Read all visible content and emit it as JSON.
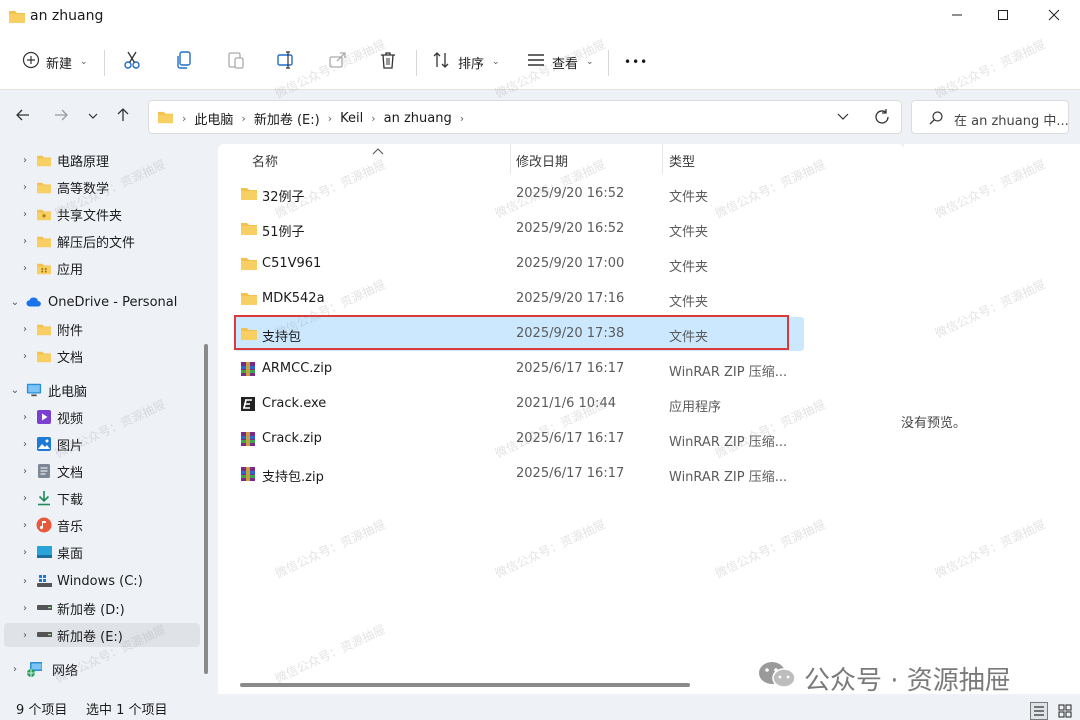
{
  "window": {
    "title": "an zhuang"
  },
  "toolbar": {
    "new_label": "新建",
    "sort_label": "排序",
    "view_label": "查看",
    "more_label": "•••"
  },
  "address": {
    "crumbs": [
      "此电脑",
      "新加卷 (E:)",
      "Keil",
      "an zhuang"
    ],
    "search_placeholder": "在 an zhuang 中..."
  },
  "sidebar": {
    "items": [
      {
        "label": "电路原理",
        "icon": "folder-icon"
      },
      {
        "label": "高等数学",
        "icon": "folder-icon"
      },
      {
        "label": "共享文件夹",
        "icon": "shared-folder-icon"
      },
      {
        "label": "解压后的文件",
        "icon": "folder-icon"
      },
      {
        "label": "应用",
        "icon": "apps-folder-icon"
      },
      {
        "label": "OneDrive - Personal",
        "icon": "onedrive-cloud-icon"
      },
      {
        "label": "附件",
        "icon": "folder-icon"
      },
      {
        "label": "文档",
        "icon": "folder-icon"
      },
      {
        "label": "此电脑",
        "icon": "computer-icon"
      },
      {
        "label": "视频",
        "icon": "videos-icon"
      },
      {
        "label": "图片",
        "icon": "pictures-icon"
      },
      {
        "label": "文档",
        "icon": "documents-icon"
      },
      {
        "label": "下载",
        "icon": "downloads-icon"
      },
      {
        "label": "音乐",
        "icon": "music-icon"
      },
      {
        "label": "桌面",
        "icon": "desktop-icon"
      },
      {
        "label": "Windows (C:)",
        "icon": "windows-drive-icon"
      },
      {
        "label": "新加卷 (D:)",
        "icon": "drive-icon"
      },
      {
        "label": "新加卷 (E:)",
        "icon": "drive-icon"
      },
      {
        "label": "网络",
        "icon": "network-icon"
      }
    ]
  },
  "columns": {
    "name": "名称",
    "date": "修改日期",
    "type": "类型"
  },
  "files": [
    {
      "name": "32例子",
      "date": "2025/9/20 16:52",
      "type": "文件夹",
      "icon": "folder-icon"
    },
    {
      "name": "51例子",
      "date": "2025/9/20 16:52",
      "type": "文件夹",
      "icon": "folder-icon"
    },
    {
      "name": "C51V961",
      "date": "2025/9/20 17:00",
      "type": "文件夹",
      "icon": "folder-icon"
    },
    {
      "name": "MDK542a",
      "date": "2025/9/20 17:16",
      "type": "文件夹",
      "icon": "folder-icon"
    },
    {
      "name": "支持包",
      "date": "2025/9/20 17:38",
      "type": "文件夹",
      "icon": "folder-icon"
    },
    {
      "name": "ARMCC.zip",
      "date": "2025/6/17 16:17",
      "type": "WinRAR ZIP 压缩...",
      "icon": "winrar-icon"
    },
    {
      "name": "Crack.exe",
      "date": "2021/1/6 10:44",
      "type": "应用程序",
      "icon": "exe-icon"
    },
    {
      "name": "Crack.zip",
      "date": "2025/6/17 16:17",
      "type": "WinRAR ZIP 压缩...",
      "icon": "winrar-icon"
    },
    {
      "name": "支持包.zip",
      "date": "2025/6/17 16:17",
      "type": "WinRAR ZIP 压缩...",
      "icon": "winrar-icon"
    }
  ],
  "preview": {
    "text": "没有预览。"
  },
  "status": {
    "count": "9 个项目",
    "selected": "选中 1 个项目"
  },
  "watermark": {
    "public": "公众号 · 资源抽屉",
    "tile": "微信公众号：资源抽屉"
  },
  "colors": {
    "folder": "#f2c14e",
    "selection": "#cce8ff",
    "highlight_border": "#d93a3a",
    "onedrive": "#1a73e8"
  }
}
